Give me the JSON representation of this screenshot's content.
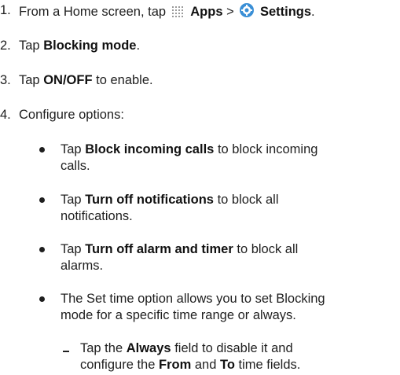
{
  "steps": [
    {
      "num": "1.",
      "pre": "From a Home screen, tap",
      "apps": "Apps",
      "sep": ">",
      "settings": "Settings",
      "end": "."
    },
    {
      "num": "2.",
      "pre": "Tap",
      "bold": "Blocking mode",
      "post": "."
    },
    {
      "num": "3.",
      "pre": "Tap",
      "bold": "ON/OFF",
      "post": "to enable."
    },
    {
      "num": "4.",
      "text": "Configure options:"
    }
  ],
  "bullets": [
    {
      "pre": "Tap",
      "bold": "Block incoming calls",
      "post1": "to block incoming",
      "post2": "calls."
    },
    {
      "pre": "Tap",
      "bold": "Turn off notifications",
      "post1": "to block all",
      "post2": "notifications."
    },
    {
      "pre": "Tap",
      "bold": "Turn off alarm and timer",
      "post1": "to block all",
      "post2": "alarms."
    },
    {
      "line1": "The Set time option allows you to set Blocking",
      "line2": "mode for a specific time range or always."
    }
  ],
  "subbullet": {
    "pre": "Tap the",
    "always": "Always",
    "mid1": "field to disable it and",
    "line2_pre": "configure the",
    "from": "From",
    "and": "and",
    "to": "To",
    "end": "time fields."
  },
  "icons": {
    "apps": "apps-grid-icon",
    "settings": "settings-gear-icon",
    "accent": "#3a8fd6"
  }
}
